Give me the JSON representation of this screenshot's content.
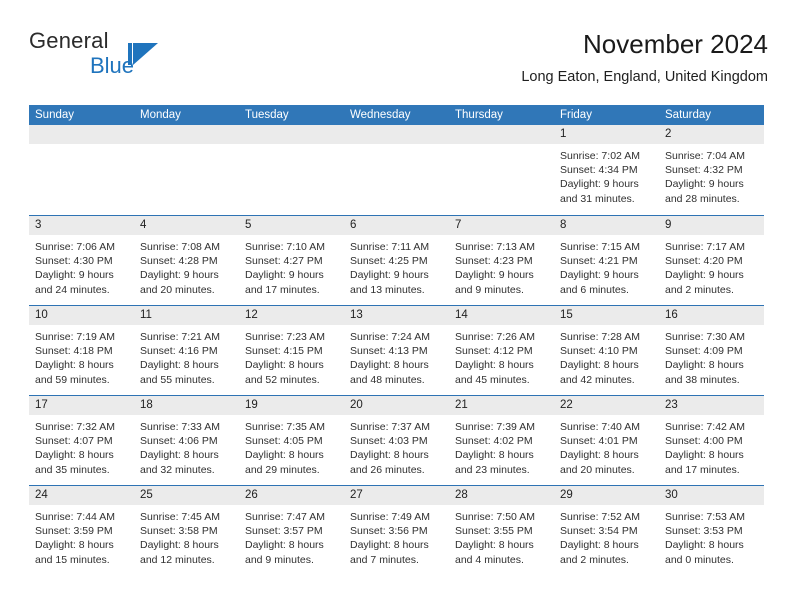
{
  "brand": {
    "name_part1": "General",
    "name_part2": "Blue",
    "logo_icon": "triangle-flag-icon",
    "accent_color": "#1f74bd"
  },
  "header": {
    "title": "November 2024",
    "subtitle": "Long Eaton, England, United Kingdom"
  },
  "colors": {
    "header_blue": "#3077b8",
    "row_divider_blue": "#2e73b4",
    "day_band_gray": "#ebebeb"
  },
  "weekdays": [
    "Sunday",
    "Monday",
    "Tuesday",
    "Wednesday",
    "Thursday",
    "Friday",
    "Saturday"
  ],
  "weeks": [
    [
      {
        "empty": true
      },
      {
        "empty": true
      },
      {
        "empty": true
      },
      {
        "empty": true
      },
      {
        "empty": true
      },
      {
        "day": "1",
        "sunrise": "Sunrise: 7:02 AM",
        "sunset": "Sunset: 4:34 PM",
        "daylight": "Daylight: 9 hours and 31 minutes."
      },
      {
        "day": "2",
        "sunrise": "Sunrise: 7:04 AM",
        "sunset": "Sunset: 4:32 PM",
        "daylight": "Daylight: 9 hours and 28 minutes."
      }
    ],
    [
      {
        "day": "3",
        "sunrise": "Sunrise: 7:06 AM",
        "sunset": "Sunset: 4:30 PM",
        "daylight": "Daylight: 9 hours and 24 minutes."
      },
      {
        "day": "4",
        "sunrise": "Sunrise: 7:08 AM",
        "sunset": "Sunset: 4:28 PM",
        "daylight": "Daylight: 9 hours and 20 minutes."
      },
      {
        "day": "5",
        "sunrise": "Sunrise: 7:10 AM",
        "sunset": "Sunset: 4:27 PM",
        "daylight": "Daylight: 9 hours and 17 minutes."
      },
      {
        "day": "6",
        "sunrise": "Sunrise: 7:11 AM",
        "sunset": "Sunset: 4:25 PM",
        "daylight": "Daylight: 9 hours and 13 minutes."
      },
      {
        "day": "7",
        "sunrise": "Sunrise: 7:13 AM",
        "sunset": "Sunset: 4:23 PM",
        "daylight": "Daylight: 9 hours and 9 minutes."
      },
      {
        "day": "8",
        "sunrise": "Sunrise: 7:15 AM",
        "sunset": "Sunset: 4:21 PM",
        "daylight": "Daylight: 9 hours and 6 minutes."
      },
      {
        "day": "9",
        "sunrise": "Sunrise: 7:17 AM",
        "sunset": "Sunset: 4:20 PM",
        "daylight": "Daylight: 9 hours and 2 minutes."
      }
    ],
    [
      {
        "day": "10",
        "sunrise": "Sunrise: 7:19 AM",
        "sunset": "Sunset: 4:18 PM",
        "daylight": "Daylight: 8 hours and 59 minutes."
      },
      {
        "day": "11",
        "sunrise": "Sunrise: 7:21 AM",
        "sunset": "Sunset: 4:16 PM",
        "daylight": "Daylight: 8 hours and 55 minutes."
      },
      {
        "day": "12",
        "sunrise": "Sunrise: 7:23 AM",
        "sunset": "Sunset: 4:15 PM",
        "daylight": "Daylight: 8 hours and 52 minutes."
      },
      {
        "day": "13",
        "sunrise": "Sunrise: 7:24 AM",
        "sunset": "Sunset: 4:13 PM",
        "daylight": "Daylight: 8 hours and 48 minutes."
      },
      {
        "day": "14",
        "sunrise": "Sunrise: 7:26 AM",
        "sunset": "Sunset: 4:12 PM",
        "daylight": "Daylight: 8 hours and 45 minutes."
      },
      {
        "day": "15",
        "sunrise": "Sunrise: 7:28 AM",
        "sunset": "Sunset: 4:10 PM",
        "daylight": "Daylight: 8 hours and 42 minutes."
      },
      {
        "day": "16",
        "sunrise": "Sunrise: 7:30 AM",
        "sunset": "Sunset: 4:09 PM",
        "daylight": "Daylight: 8 hours and 38 minutes."
      }
    ],
    [
      {
        "day": "17",
        "sunrise": "Sunrise: 7:32 AM",
        "sunset": "Sunset: 4:07 PM",
        "daylight": "Daylight: 8 hours and 35 minutes."
      },
      {
        "day": "18",
        "sunrise": "Sunrise: 7:33 AM",
        "sunset": "Sunset: 4:06 PM",
        "daylight": "Daylight: 8 hours and 32 minutes."
      },
      {
        "day": "19",
        "sunrise": "Sunrise: 7:35 AM",
        "sunset": "Sunset: 4:05 PM",
        "daylight": "Daylight: 8 hours and 29 minutes."
      },
      {
        "day": "20",
        "sunrise": "Sunrise: 7:37 AM",
        "sunset": "Sunset: 4:03 PM",
        "daylight": "Daylight: 8 hours and 26 minutes."
      },
      {
        "day": "21",
        "sunrise": "Sunrise: 7:39 AM",
        "sunset": "Sunset: 4:02 PM",
        "daylight": "Daylight: 8 hours and 23 minutes."
      },
      {
        "day": "22",
        "sunrise": "Sunrise: 7:40 AM",
        "sunset": "Sunset: 4:01 PM",
        "daylight": "Daylight: 8 hours and 20 minutes."
      },
      {
        "day": "23",
        "sunrise": "Sunrise: 7:42 AM",
        "sunset": "Sunset: 4:00 PM",
        "daylight": "Daylight: 8 hours and 17 minutes."
      }
    ],
    [
      {
        "day": "24",
        "sunrise": "Sunrise: 7:44 AM",
        "sunset": "Sunset: 3:59 PM",
        "daylight": "Daylight: 8 hours and 15 minutes."
      },
      {
        "day": "25",
        "sunrise": "Sunrise: 7:45 AM",
        "sunset": "Sunset: 3:58 PM",
        "daylight": "Daylight: 8 hours and 12 minutes."
      },
      {
        "day": "26",
        "sunrise": "Sunrise: 7:47 AM",
        "sunset": "Sunset: 3:57 PM",
        "daylight": "Daylight: 8 hours and 9 minutes."
      },
      {
        "day": "27",
        "sunrise": "Sunrise: 7:49 AM",
        "sunset": "Sunset: 3:56 PM",
        "daylight": "Daylight: 8 hours and 7 minutes."
      },
      {
        "day": "28",
        "sunrise": "Sunrise: 7:50 AM",
        "sunset": "Sunset: 3:55 PM",
        "daylight": "Daylight: 8 hours and 4 minutes."
      },
      {
        "day": "29",
        "sunrise": "Sunrise: 7:52 AM",
        "sunset": "Sunset: 3:54 PM",
        "daylight": "Daylight: 8 hours and 2 minutes."
      },
      {
        "day": "30",
        "sunrise": "Sunrise: 7:53 AM",
        "sunset": "Sunset: 3:53 PM",
        "daylight": "Daylight: 8 hours and 0 minutes."
      }
    ]
  ]
}
